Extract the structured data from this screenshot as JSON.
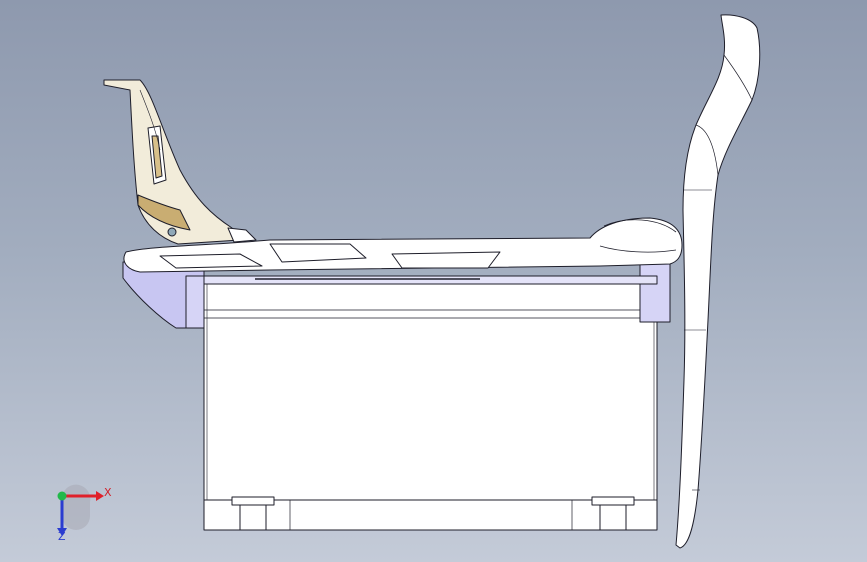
{
  "view": {
    "background_top": "#8e99ae",
    "background_bottom": "#c4cbd8",
    "part_color": "#ffffff",
    "shade_color": "#c8c6f2",
    "edge_color": "#1e1e2a",
    "bracket_tint": "#b89a5a"
  },
  "triad": {
    "x_label": "X",
    "z_label": "Z",
    "x_color": "#e0202a",
    "y_color": "#22b84a",
    "z_color": "#2a3cd0"
  }
}
